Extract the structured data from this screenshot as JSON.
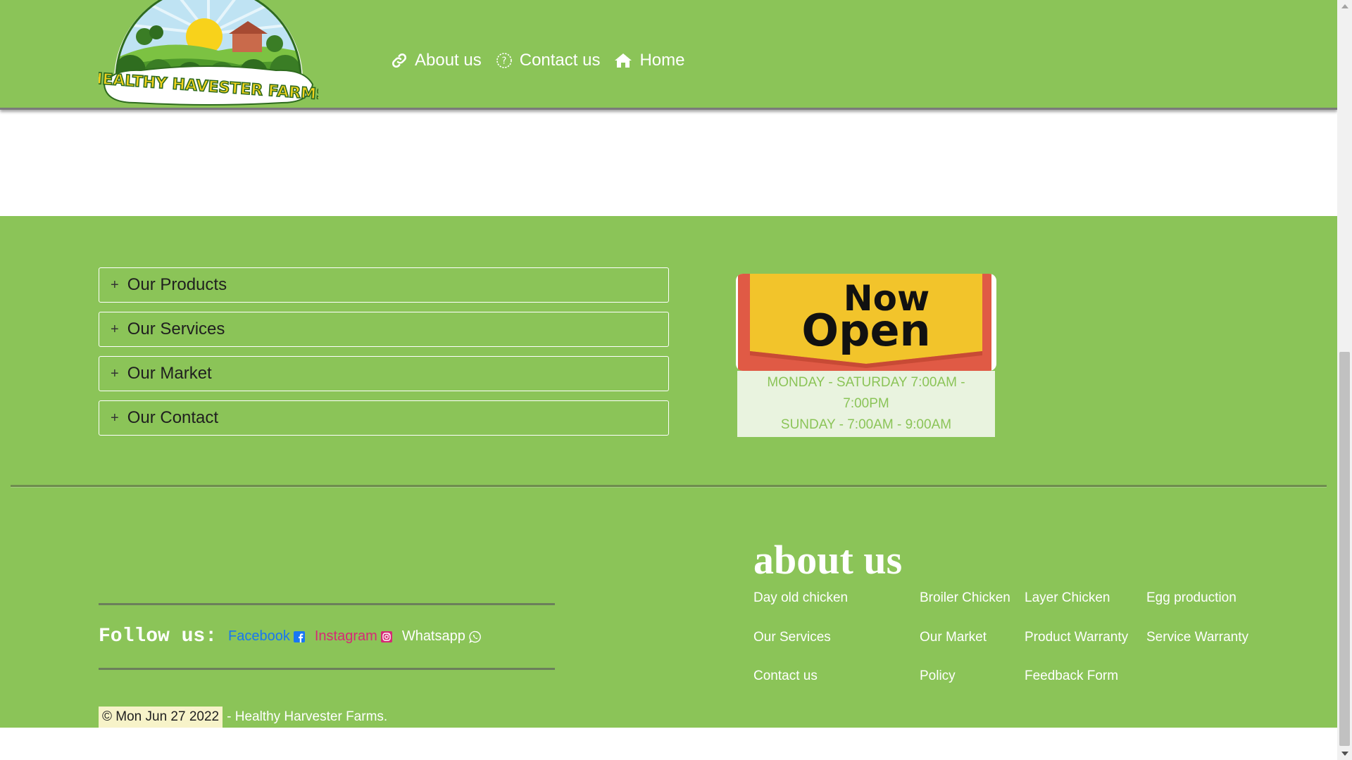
{
  "header": {
    "logo_text": "HEALTHY HAVESTER FARMS",
    "nav": [
      {
        "label": "About us",
        "icon": "link-icon"
      },
      {
        "label": "Contact us",
        "icon": "question-circle-icon"
      },
      {
        "label": "Home",
        "icon": "home-icon"
      }
    ]
  },
  "footer": {
    "accordion": [
      {
        "label": "Our Products"
      },
      {
        "label": "Our Services"
      },
      {
        "label": "Our Market"
      },
      {
        "label": "Our Contact"
      }
    ],
    "open_sign_text": [
      "Now",
      "Open"
    ],
    "hours": {
      "line1": "MONDAY - SATURDAY 7:00AM -",
      "line2": "7:00PM",
      "line3": "SUNDAY - 7:00AM - 9:00AM"
    },
    "follow": {
      "label": "Follow us:",
      "facebook": "Facebook",
      "instagram": "Instagram",
      "whatsapp": "Whatsapp"
    },
    "copyright": {
      "symbol_date": "©  Mon Jun 27 2022",
      "rest": "- Healthy Harvester Farms."
    },
    "about": {
      "title": "about us",
      "links": [
        "Day old chicken",
        "Broiler Chicken",
        "Layer Chicken",
        "Egg production",
        "Our Services",
        "Our Market",
        "Product Warranty",
        "Service Warranty",
        "Contact us",
        "Policy",
        "Feedback Form"
      ]
    }
  },
  "colors": {
    "brand_green": "#8bc458",
    "hours_bg": "#e9f3df",
    "facebook": "#1877f2",
    "instagram": "#d62976"
  }
}
